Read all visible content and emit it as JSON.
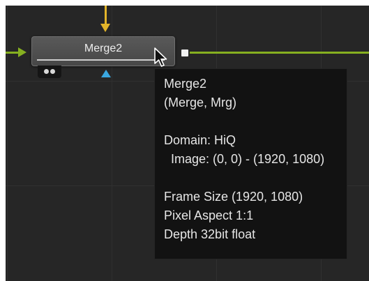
{
  "node": {
    "title": "Merge2"
  },
  "tooltip": {
    "lines": [
      "Merge2",
      "(Merge, Mrg)",
      "",
      "Domain: HiQ",
      "  Image: (0, 0) - (1920, 1080)",
      "",
      "Frame Size (1920, 1080)",
      "Pixel Aspect 1:1",
      "Depth 32bit float"
    ]
  },
  "colors": {
    "background_input_wire": "#86b020",
    "foreground_input_wire": "#e3b52a",
    "mask_input": "#3aa7e0",
    "canvas": "#262626"
  },
  "icons": [
    "background-input-triangle",
    "foreground-input-triangle",
    "mask-input-triangle",
    "output-square",
    "mouse-pointer-icon"
  ]
}
